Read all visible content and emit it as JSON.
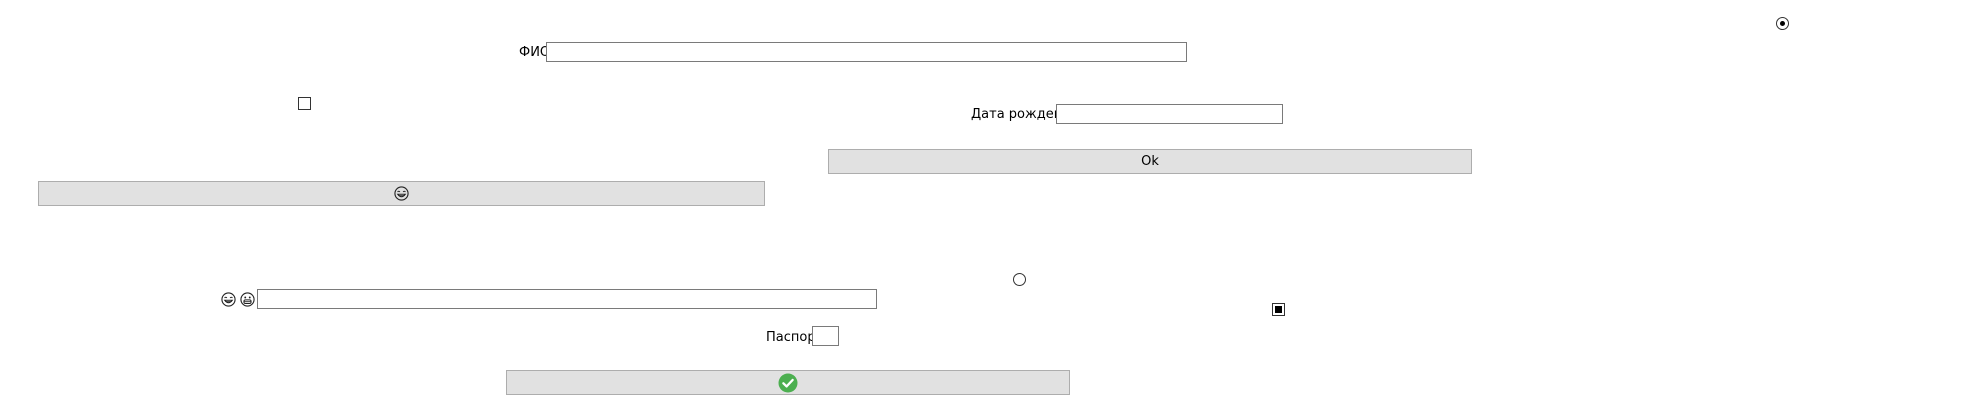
{
  "form": {
    "fio_label": "ФИО",
    "fio_value": "",
    "birth_label": "Дата рождения",
    "birth_value": "",
    "passport_label": "Паспорт",
    "passport_value": "",
    "emoji_field_value": "",
    "ok_button_label": "Ok",
    "radio_top_checked": true,
    "radio_middle_checked": false,
    "checkbox_left_checked": false,
    "checkbox_right_checked": true
  },
  "icons": {
    "emoji_button_icon": "grinning-face-icon",
    "emoji_field_icons": [
      "grinning-face-icon",
      "big-smile-face-icon"
    ],
    "submit_button_icon": "green-checkmark-icon"
  },
  "colors": {
    "button_bg": "#e1e1e1",
    "button_border": "#adadad",
    "textbox_border": "#7a7a7a",
    "check_green": "#4caf50"
  }
}
